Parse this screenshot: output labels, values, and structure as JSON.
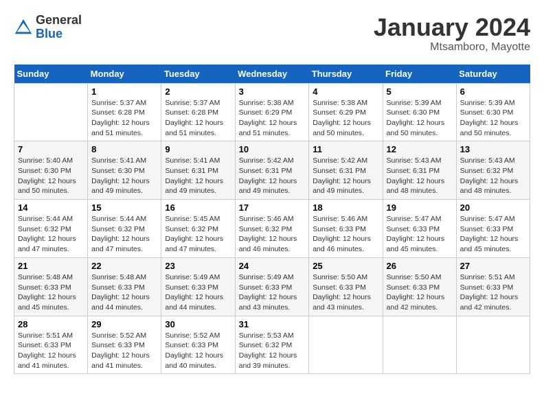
{
  "header": {
    "logo_general": "General",
    "logo_blue": "Blue",
    "month_title": "January 2024",
    "location": "Mtsamboro, Mayotte"
  },
  "calendar": {
    "columns": [
      "Sunday",
      "Monday",
      "Tuesday",
      "Wednesday",
      "Thursday",
      "Friday",
      "Saturday"
    ],
    "weeks": [
      [
        {
          "day": "",
          "info": ""
        },
        {
          "day": "1",
          "info": "Sunrise: 5:37 AM\nSunset: 6:28 PM\nDaylight: 12 hours\nand 51 minutes."
        },
        {
          "day": "2",
          "info": "Sunrise: 5:37 AM\nSunset: 6:28 PM\nDaylight: 12 hours\nand 51 minutes."
        },
        {
          "day": "3",
          "info": "Sunrise: 5:38 AM\nSunset: 6:29 PM\nDaylight: 12 hours\nand 51 minutes."
        },
        {
          "day": "4",
          "info": "Sunrise: 5:38 AM\nSunset: 6:29 PM\nDaylight: 12 hours\nand 50 minutes."
        },
        {
          "day": "5",
          "info": "Sunrise: 5:39 AM\nSunset: 6:30 PM\nDaylight: 12 hours\nand 50 minutes."
        },
        {
          "day": "6",
          "info": "Sunrise: 5:39 AM\nSunset: 6:30 PM\nDaylight: 12 hours\nand 50 minutes."
        }
      ],
      [
        {
          "day": "7",
          "info": "Sunrise: 5:40 AM\nSunset: 6:30 PM\nDaylight: 12 hours\nand 50 minutes."
        },
        {
          "day": "8",
          "info": "Sunrise: 5:41 AM\nSunset: 6:30 PM\nDaylight: 12 hours\nand 49 minutes."
        },
        {
          "day": "9",
          "info": "Sunrise: 5:41 AM\nSunset: 6:31 PM\nDaylight: 12 hours\nand 49 minutes."
        },
        {
          "day": "10",
          "info": "Sunrise: 5:42 AM\nSunset: 6:31 PM\nDaylight: 12 hours\nand 49 minutes."
        },
        {
          "day": "11",
          "info": "Sunrise: 5:42 AM\nSunset: 6:31 PM\nDaylight: 12 hours\nand 49 minutes."
        },
        {
          "day": "12",
          "info": "Sunrise: 5:43 AM\nSunset: 6:31 PM\nDaylight: 12 hours\nand 48 minutes."
        },
        {
          "day": "13",
          "info": "Sunrise: 5:43 AM\nSunset: 6:32 PM\nDaylight: 12 hours\nand 48 minutes."
        }
      ],
      [
        {
          "day": "14",
          "info": "Sunrise: 5:44 AM\nSunset: 6:32 PM\nDaylight: 12 hours\nand 47 minutes."
        },
        {
          "day": "15",
          "info": "Sunrise: 5:44 AM\nSunset: 6:32 PM\nDaylight: 12 hours\nand 47 minutes."
        },
        {
          "day": "16",
          "info": "Sunrise: 5:45 AM\nSunset: 6:32 PM\nDaylight: 12 hours\nand 47 minutes."
        },
        {
          "day": "17",
          "info": "Sunrise: 5:46 AM\nSunset: 6:32 PM\nDaylight: 12 hours\nand 46 minutes."
        },
        {
          "day": "18",
          "info": "Sunrise: 5:46 AM\nSunset: 6:33 PM\nDaylight: 12 hours\nand 46 minutes."
        },
        {
          "day": "19",
          "info": "Sunrise: 5:47 AM\nSunset: 6:33 PM\nDaylight: 12 hours\nand 45 minutes."
        },
        {
          "day": "20",
          "info": "Sunrise: 5:47 AM\nSunset: 6:33 PM\nDaylight: 12 hours\nand 45 minutes."
        }
      ],
      [
        {
          "day": "21",
          "info": "Sunrise: 5:48 AM\nSunset: 6:33 PM\nDaylight: 12 hours\nand 45 minutes."
        },
        {
          "day": "22",
          "info": "Sunrise: 5:48 AM\nSunset: 6:33 PM\nDaylight: 12 hours\nand 44 minutes."
        },
        {
          "day": "23",
          "info": "Sunrise: 5:49 AM\nSunset: 6:33 PM\nDaylight: 12 hours\nand 44 minutes."
        },
        {
          "day": "24",
          "info": "Sunrise: 5:49 AM\nSunset: 6:33 PM\nDaylight: 12 hours\nand 43 minutes."
        },
        {
          "day": "25",
          "info": "Sunrise: 5:50 AM\nSunset: 6:33 PM\nDaylight: 12 hours\nand 43 minutes."
        },
        {
          "day": "26",
          "info": "Sunrise: 5:50 AM\nSunset: 6:33 PM\nDaylight: 12 hours\nand 42 minutes."
        },
        {
          "day": "27",
          "info": "Sunrise: 5:51 AM\nSunset: 6:33 PM\nDaylight: 12 hours\nand 42 minutes."
        }
      ],
      [
        {
          "day": "28",
          "info": "Sunrise: 5:51 AM\nSunset: 6:33 PM\nDaylight: 12 hours\nand 41 minutes."
        },
        {
          "day": "29",
          "info": "Sunrise: 5:52 AM\nSunset: 6:33 PM\nDaylight: 12 hours\nand 41 minutes."
        },
        {
          "day": "30",
          "info": "Sunrise: 5:52 AM\nSunset: 6:33 PM\nDaylight: 12 hours\nand 40 minutes."
        },
        {
          "day": "31",
          "info": "Sunrise: 5:53 AM\nSunset: 6:32 PM\nDaylight: 12 hours\nand 39 minutes."
        },
        {
          "day": "",
          "info": ""
        },
        {
          "day": "",
          "info": ""
        },
        {
          "day": "",
          "info": ""
        }
      ]
    ]
  }
}
